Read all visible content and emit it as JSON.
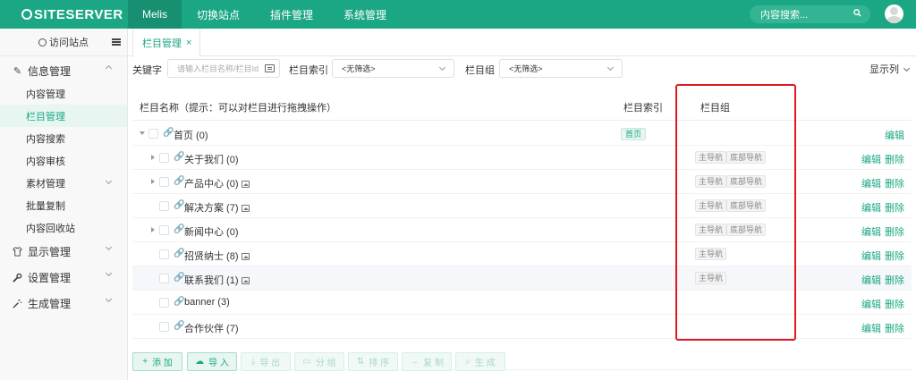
{
  "app": {
    "logo": "SITESERVER"
  },
  "topnav": {
    "items": [
      "Melis",
      "切换站点",
      "插件管理",
      "系统管理"
    ],
    "search_placeholder": "内容搜索..."
  },
  "sidebar": {
    "visit_site": "访问站点",
    "groups": [
      {
        "label": "信息管理",
        "icon": "edit-icon"
      },
      {
        "label": "显示管理",
        "icon": "shirt-icon"
      },
      {
        "label": "设置管理",
        "icon": "wrench-icon"
      },
      {
        "label": "生成管理",
        "icon": "magic-wand-icon"
      }
    ],
    "sub_items": [
      "内容管理",
      "栏目管理",
      "内容搜索",
      "内容审核",
      "素材管理",
      "批量复制",
      "内容回收站"
    ]
  },
  "tab": {
    "label": "栏目管理",
    "close": "×"
  },
  "filters": {
    "keyword_label": "关键字",
    "keyword_placeholder": "请输入栏目名称/栏目Id",
    "index_label": "栏目索引",
    "index_value": "<无筛选>",
    "group_label": "栏目组",
    "group_value": "<无筛选>",
    "show_columns": "显示列"
  },
  "table": {
    "headers": {
      "name": "栏目名称（提示：可以对栏目进行拖拽操作）",
      "index": "栏目索引",
      "group": "栏目组"
    },
    "rows": [
      {
        "name": "首页 (0)",
        "index_tag": "首页",
        "groups": [],
        "edit": "编辑",
        "delete": ""
      },
      {
        "name": "关于我们 (0)",
        "index_tag": "",
        "groups": [
          "主导航",
          "底部导航"
        ],
        "edit": "编辑",
        "delete": "删除"
      },
      {
        "name": "产品中心 (0)",
        "index_tag": "",
        "groups": [
          "主导航",
          "底部导航"
        ],
        "edit": "编辑",
        "delete": "删除"
      },
      {
        "name": "解决方案 (7)",
        "index_tag": "",
        "groups": [
          "主导航",
          "底部导航"
        ],
        "edit": "编辑",
        "delete": "删除"
      },
      {
        "name": "新闻中心 (0)",
        "index_tag": "",
        "groups": [
          "主导航",
          "底部导航"
        ],
        "edit": "编辑",
        "delete": "删除"
      },
      {
        "name": "招贤纳士 (8)",
        "index_tag": "",
        "groups": [
          "主导航"
        ],
        "edit": "编辑",
        "delete": "删除"
      },
      {
        "name": "联系我们 (1)",
        "index_tag": "",
        "groups": [
          "主导航"
        ],
        "edit": "编辑",
        "delete": "删除"
      },
      {
        "name": "banner (3)",
        "index_tag": "",
        "groups": [],
        "edit": "编辑",
        "delete": "删除"
      },
      {
        "name": "合作伙伴 (7)",
        "index_tag": "",
        "groups": [],
        "edit": "编辑",
        "delete": "删除"
      }
    ]
  },
  "actions": {
    "add": "添 加",
    "import": "导 入",
    "export": "导 出",
    "group": "分 组",
    "sort": "排 序",
    "copy": "复 制",
    "generate": "生 成"
  },
  "colors": {
    "brand": "#1ba784",
    "highlight_box": "#e0191e"
  }
}
